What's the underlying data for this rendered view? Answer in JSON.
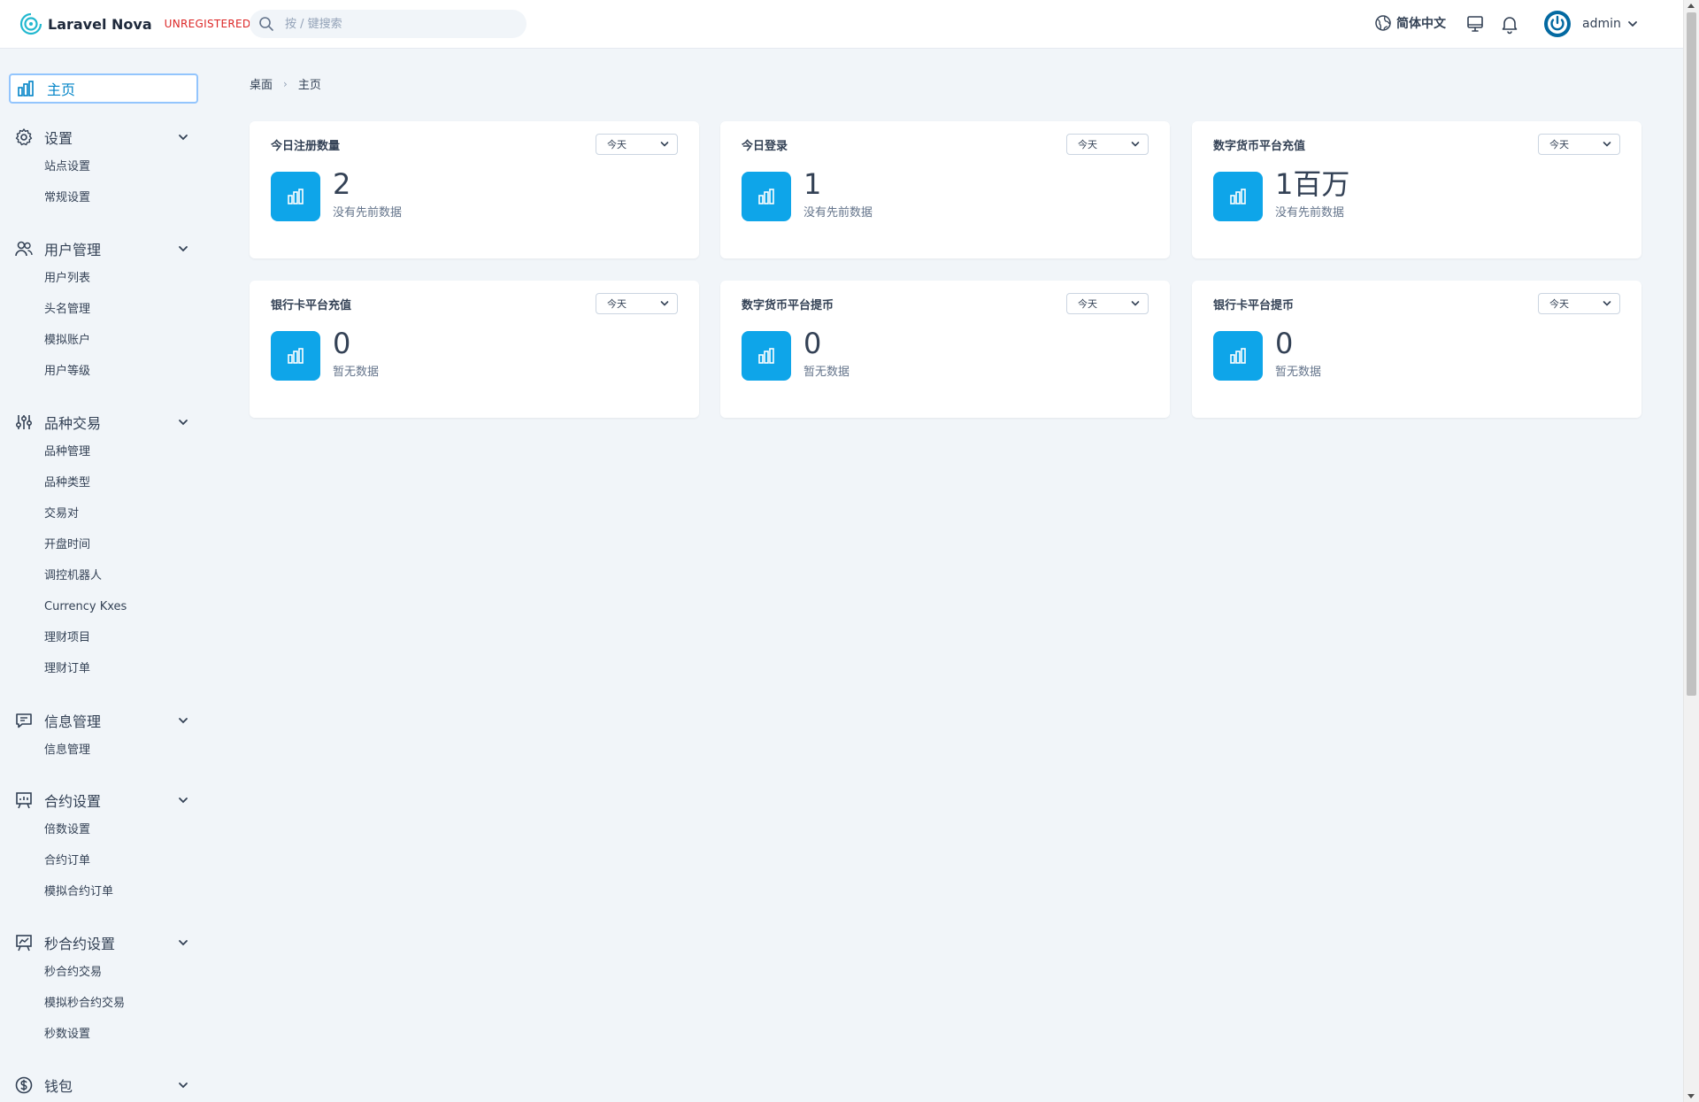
{
  "header": {
    "app_name": "Laravel Nova",
    "license_badge": "UNREGISTERED",
    "search_placeholder": "按 / 键搜索",
    "language_label": "简体中文",
    "user_name": "admin",
    "icons": [
      "search-icon",
      "globe-icon",
      "monitor-icon",
      "bell-icon",
      "power-avatar-icon",
      "chevron-down-icon"
    ]
  },
  "sidebar": {
    "active": {
      "label": "主页",
      "icon": "chart-icon"
    },
    "sections": [
      {
        "title": "设置",
        "icon": "gear-icon",
        "items": [
          "站点设置",
          "常规设置"
        ]
      },
      {
        "title": "用户管理",
        "icon": "users-icon",
        "items": [
          "用户列表",
          "头名管理",
          "模拟账户",
          "用户等级"
        ]
      },
      {
        "title": "品种交易",
        "icon": "sliders-icon",
        "items": [
          "品种管理",
          "品种类型",
          "交易对",
          "开盘时间",
          "调控机器人",
          "Currency Kxes",
          "理财项目",
          "理财订单"
        ]
      },
      {
        "title": "信息管理",
        "icon": "message-icon",
        "items": [
          "信息管理"
        ]
      },
      {
        "title": "合约设置",
        "icon": "presentation-icon",
        "items": [
          "倍数设置",
          "合约订单",
          "模拟合约订单"
        ]
      },
      {
        "title": "秒合约设置",
        "icon": "chart-board-icon",
        "items": [
          "秒合约交易",
          "模拟秒合约交易",
          "秒数设置"
        ]
      },
      {
        "title": "钱包",
        "icon": "dollar-icon",
        "items": []
      }
    ]
  },
  "breadcrumb": {
    "root": "桌面",
    "current": "主页"
  },
  "cards": [
    {
      "title": "今日注册数量",
      "range": "今天",
      "value": "2",
      "subtitle": "没有先前数据"
    },
    {
      "title": "今日登录",
      "range": "今天",
      "value": "1",
      "subtitle": "没有先前数据"
    },
    {
      "title": "数字货币平台充值",
      "range": "今天",
      "value": "1百万",
      "subtitle": "没有先前数据"
    },
    {
      "title": "银行卡平台充值",
      "range": "今天",
      "value": "0",
      "subtitle": "暂无数据"
    },
    {
      "title": "数字货币平台提币",
      "range": "今天",
      "value": "0",
      "subtitle": "暂无数据"
    },
    {
      "title": "银行卡平台提币",
      "range": "今天",
      "value": "0",
      "subtitle": "暂无数据"
    }
  ],
  "colors": {
    "accent": "#0ea5e9",
    "active_text": "#0284c7",
    "badge_red": "#dc2626",
    "background": "#f1f5f9"
  }
}
